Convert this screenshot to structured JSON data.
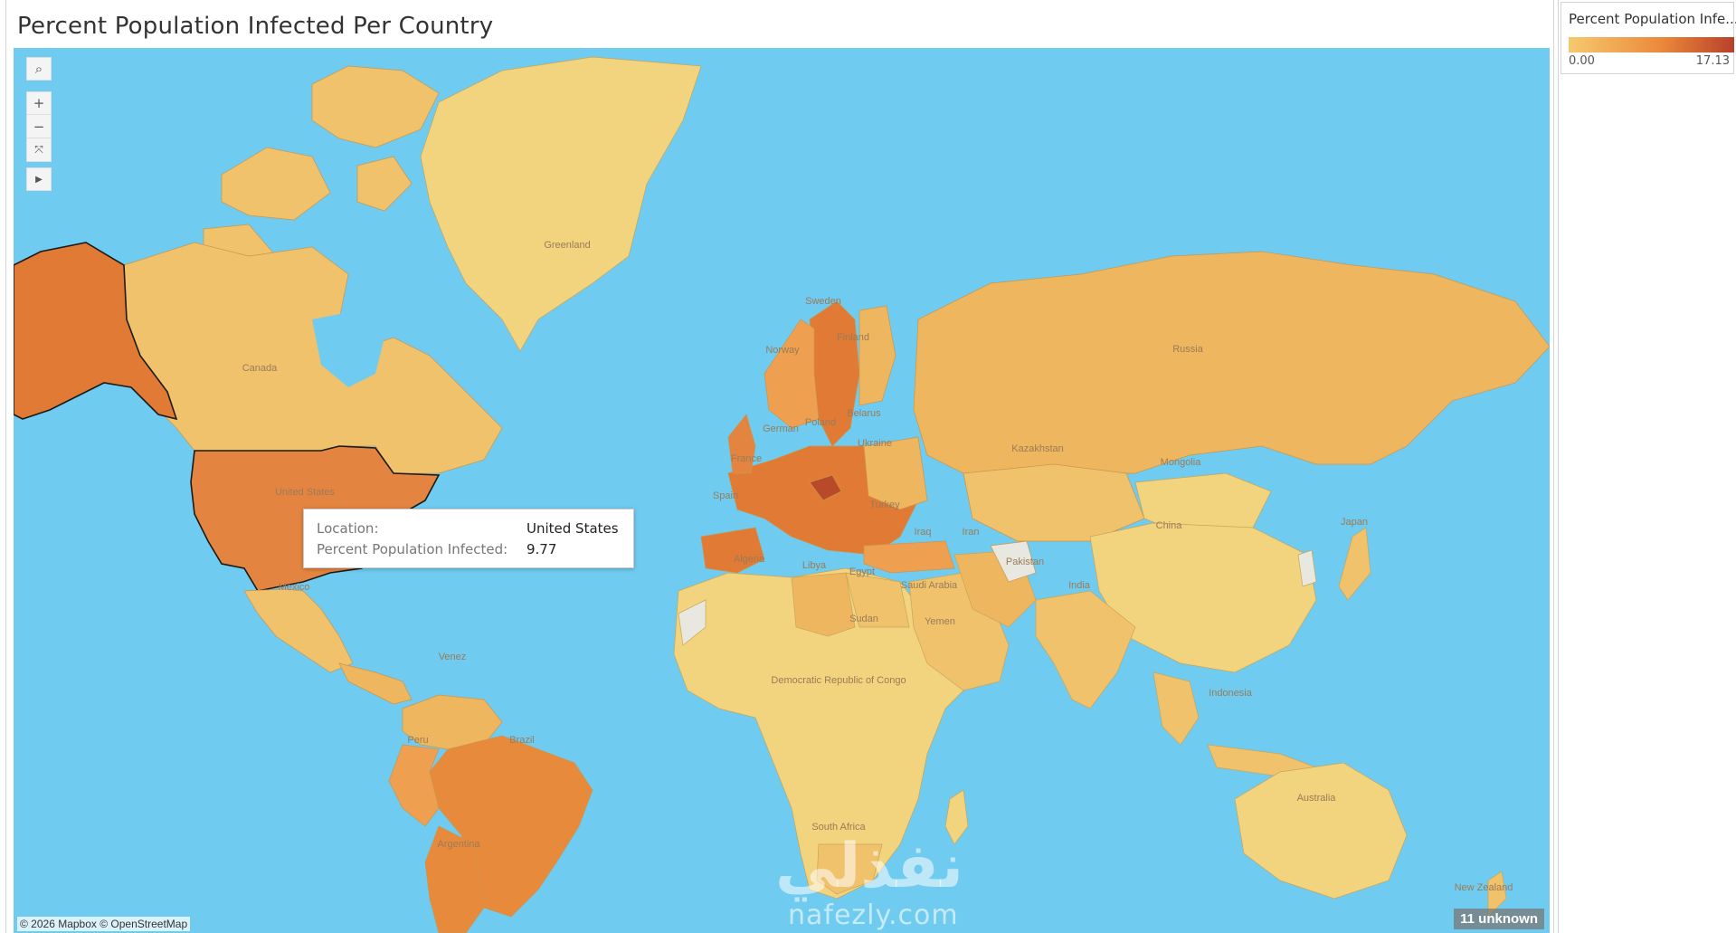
{
  "sheet": {
    "title": "Percent Population Infected Per Country"
  },
  "map": {
    "background_color": "#6fcbef",
    "attribution": "© 2026 Mapbox © OpenStreetMap",
    "unknown_badge": "11 unknown",
    "controls": {
      "search_icon": "magnifier-icon",
      "zoom_in": "+",
      "zoom_out": "−",
      "reset_icon": "reset-map-icon",
      "expand_icon": "play-triangle-icon"
    },
    "country_labels": {
      "greenland": "Greenland",
      "canada": "Canada",
      "united_states": "United States",
      "mexico": "Mexico",
      "venezuela": "Venez",
      "peru": "Peru",
      "brazil": "Brazil",
      "argentina": "Argentina",
      "sweden": "Sweden",
      "finland": "Finland",
      "norway": "Norway",
      "poland": "Poland",
      "germany": "German",
      "belarus": "Belarus",
      "ukraine": "Ukraine",
      "france": "France",
      "spain": "Spain",
      "turkey": "Turkey",
      "iraq": "Iraq",
      "iran": "Iran",
      "algeria": "Algeria",
      "libya": "Libya",
      "egypt": "Egypt",
      "saudi_arabia": "Saudi Arabia",
      "yemen": "Yemen",
      "sudan": "Sudan",
      "drc": "Democratic Republic of Congo",
      "south_africa": "South Africa",
      "russia": "Russia",
      "kazakhstan": "Kazakhstan",
      "mongolia": "Mongolia",
      "china": "China",
      "pakistan": "Pakistan",
      "india": "India",
      "japan": "Japan",
      "indonesia": "Indonesia",
      "australia": "Australia",
      "new_zealand": "New Zealand"
    },
    "fill_colors": {
      "lowest": "#f2d47e",
      "low": "#f0c26c",
      "mid_low": "#efb660",
      "mid": "#eea050",
      "high": "#e88a3c",
      "very_high": "#e07a35",
      "highest": "#b84a2a",
      "no_data": "#e8e8e0"
    }
  },
  "tooltip": {
    "location_key": "Location:",
    "location_value": "United States",
    "metric_key": "Percent Population Infected:",
    "metric_value": "9.77"
  },
  "legend": {
    "title": "Percent Population Infe...",
    "min": "0.00",
    "max": "17.13",
    "gradient_start": "#f6c96f",
    "gradient_mid": "#ec8a3b",
    "gradient_end": "#b9402a"
  },
  "watermark": {
    "arabic": "نفذلي",
    "latin": "nafezly.com"
  }
}
